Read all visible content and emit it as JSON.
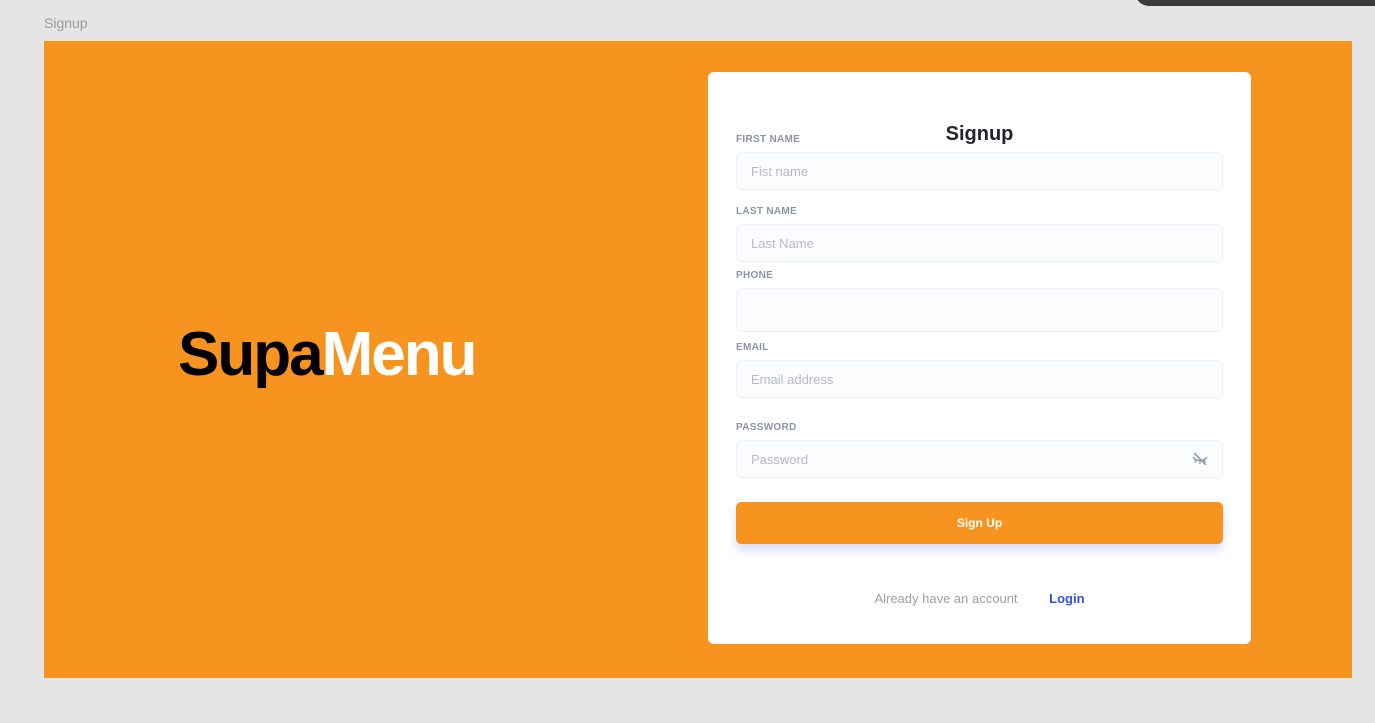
{
  "frame_label": "Signup",
  "brand": {
    "part_dark": "Supa",
    "part_light": "Menu"
  },
  "form": {
    "title": "Signup",
    "first_name": {
      "label": "FIRST NAME",
      "placeholder": "Fist name",
      "value": ""
    },
    "last_name": {
      "label": "LAST NAME",
      "placeholder": "Last Name",
      "value": ""
    },
    "phone": {
      "label": "PHONE",
      "placeholder": "",
      "value": ""
    },
    "email": {
      "label": "EMAIL",
      "placeholder": "Email address",
      "value": ""
    },
    "password": {
      "label": "PASSWORD",
      "placeholder": "Password",
      "value": "",
      "toggle_icon": "eye-off-icon"
    },
    "submit_label": "Sign Up",
    "footer": {
      "text": "Already have an account",
      "link_label": "Login"
    }
  },
  "colors": {
    "accent": "#f7941f",
    "link": "#3452d9",
    "background": "#e5e5e5"
  }
}
